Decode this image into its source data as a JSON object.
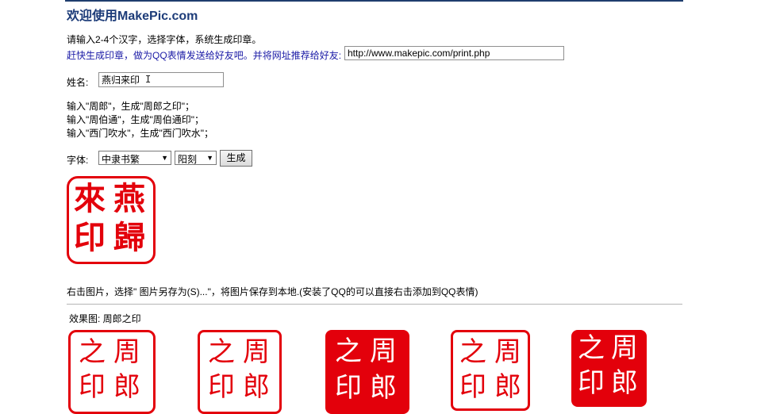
{
  "header": {
    "title": "欢迎使用MakePic.com"
  },
  "intro": {
    "instruction": "请输入2-4个汉字，选择字体，系统生成印章。",
    "promo_text": "赶快生成印章，做为",
    "promo_link": "QQ表情",
    "promo_rest": "发送给好友吧。并将网址推荐给好友:",
    "share_url": "http://www.makepic.com/print.php"
  },
  "name_field": {
    "label": "姓名:",
    "value": "燕归来印"
  },
  "examples": [
    "输入\"周郎\"，生成\"周郎之印\"；",
    "输入\"周伯通\"，生成\"周伯通印\"；",
    "输入\"西门吹水\"，生成\"西门吹水\"；"
  ],
  "controls": {
    "font_label": "字体:",
    "font_selected": "中隶书繁",
    "style_selected": "阳刻",
    "generate_label": "生成",
    "dropdown_icon": "chevron-down-icon"
  },
  "result_seal": {
    "chars": [
      "燕",
      "歸",
      "來",
      "印"
    ],
    "color": "#e3000b"
  },
  "save_tip": "右击图片，选择\" 图片另存为(S)...\"，将图片保存到本地.(安装了QQ的可以直接右击添加到QQ表情)",
  "effects": {
    "label": "效果图: 周郎之印",
    "seals": [
      {
        "chars": [
          "周",
          "郎",
          "之",
          "印"
        ],
        "style": "outline"
      },
      {
        "chars": [
          "周",
          "郎",
          "之",
          "印"
        ],
        "style": "outline"
      },
      {
        "chars": [
          "周",
          "郎",
          "之",
          "印"
        ],
        "style": "solid"
      },
      {
        "chars": [
          "周",
          "郎",
          "之",
          "印"
        ],
        "style": "outline"
      },
      {
        "chars": [
          "周",
          "郎",
          "之",
          "印"
        ],
        "style": "solid"
      }
    ]
  }
}
